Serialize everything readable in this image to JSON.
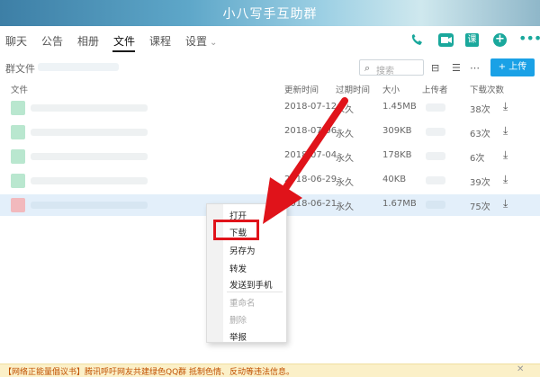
{
  "title": "小八写手互助群",
  "tabs": [
    {
      "label": "聊天"
    },
    {
      "label": "公告"
    },
    {
      "label": "相册"
    },
    {
      "label": "文件"
    },
    {
      "label": "课程"
    },
    {
      "label": "设置"
    }
  ],
  "active_tab": "文件",
  "toolbar": {
    "crumb": "群文件",
    "search_placeholder": "搜索",
    "upload_label": "+ 上传",
    "course_icon_text": "课"
  },
  "columns": [
    "文件",
    "更新时间",
    "过期时间",
    "大小",
    "上传者",
    "下载次数"
  ],
  "rows": [
    {
      "updated": "2018-07-12",
      "expires": "永久",
      "size": "1.45MB",
      "downloads": "38次"
    },
    {
      "updated": "2018-07-06",
      "expires": "永久",
      "size": "309KB",
      "downloads": "63次"
    },
    {
      "updated": "2018-07-04",
      "expires": "永久",
      "size": "178KB",
      "downloads": "6次"
    },
    {
      "updated": "2018-06-29",
      "expires": "永久",
      "size": "40KB",
      "downloads": "39次"
    },
    {
      "updated": "2018-06-21",
      "expires": "永久",
      "size": "1.67MB",
      "downloads": "75次"
    }
  ],
  "context_menu": {
    "items": [
      "打开",
      "下载",
      "另存为",
      "转发",
      "发送到手机",
      "重命名",
      "删除",
      "举报"
    ],
    "highlighted": "下载"
  },
  "status_message": "【网络正能量倡议书】腾讯呼吁网友共建绿色QQ群 抵制色情、反动等违法信息。",
  "colors": {
    "accent": "#1aa89c",
    "upload": "#1aa1e6",
    "annotation": "#e0131a",
    "selected_row": "#e3effa"
  }
}
